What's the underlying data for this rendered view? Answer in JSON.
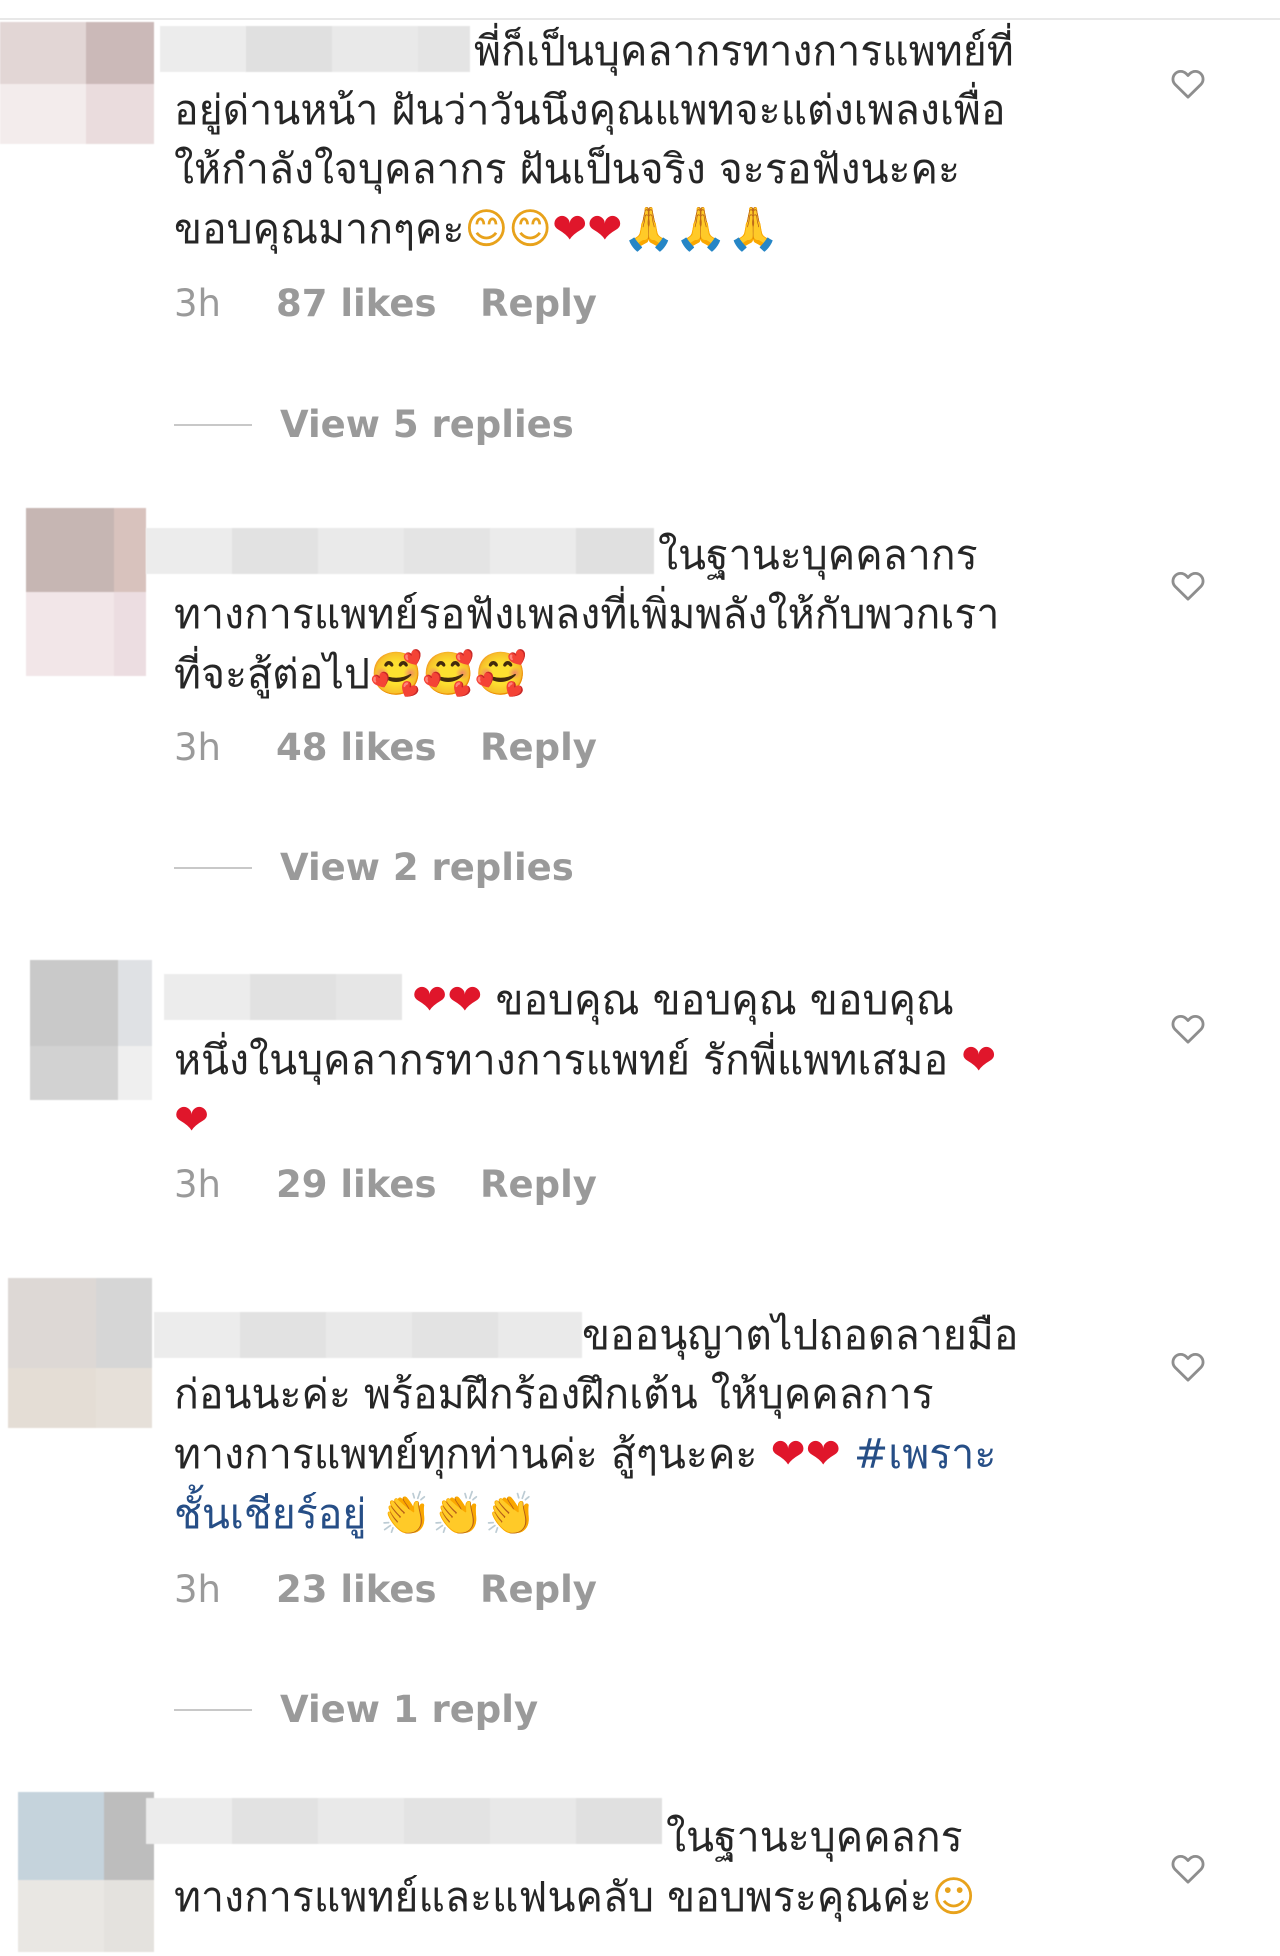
{
  "comments": [
    {
      "lead": "พี่ก็เป็นบุคลากรทางการแพทย์ที่",
      "lines": [
        "อยู่ด่านหน้า ฝันว่าวันนึงคุณแพทจะแต่งเพลงเพื่อ",
        "ให้กำลังใจบุคลากร ฝันเป็นจริง จะรอฟังนะคะ",
        "ขอบคุณมากๆคะ"
      ],
      "emoji": [
        "😊",
        "😊",
        "❤",
        "❤",
        "🙏",
        "🙏",
        "🙏"
      ],
      "time": "3h",
      "likes": "87 likes",
      "reply": "Reply",
      "view_replies": "View 5 replies"
    },
    {
      "lead": "ในฐานะบุคคลากร",
      "lines": [
        "ทางการแพทย์รอฟังเพลงที่เพิ่มพลังให้กับพวกเรา",
        "ที่จะสู้ต่อไป"
      ],
      "emoji": [
        "🥰",
        "🥰",
        "🥰"
      ],
      "time": "3h",
      "likes": "48 likes",
      "reply": "Reply",
      "view_replies": "View 2 replies"
    },
    {
      "lead": "ขอบคุณ ขอบคุณ ขอบคุณ",
      "lead_emoji": [
        "❤",
        "❤"
      ],
      "lines": [
        "หนึ่งในบุคลากรทางการแพทย์ รักพี่แพทเสมอ"
      ],
      "emoji": [
        "❤"
      ],
      "trailing_emoji": [
        "❤"
      ],
      "time": "3h",
      "likes": "29 likes",
      "reply": "Reply"
    },
    {
      "lead": "ขออนุญาตไปถอดลายมือ",
      "lines": [
        "ก่อนนะค่ะ พร้อมฝึกร้องฝึกเต้น ให้บุคคลการ",
        "ทางการแพทย์ทุกท่านค่ะ สู้ๆนะคะ"
      ],
      "emoji": [
        "❤",
        "❤"
      ],
      "hashtag_part1": "#เพราะ",
      "hashtag_part2": "ชั้นเชียร์อยู่",
      "trailing_emoji": [
        "👏",
        "👏",
        "👏"
      ],
      "time": "3h",
      "likes": "23 likes",
      "reply": "Reply",
      "view_replies": "View 1 reply"
    },
    {
      "lead": "ในฐานะบุคคลกร",
      "lines": [
        "ทางการแพทย์และแฟนคลับ ขอบพระคุณค่ะ"
      ],
      "emoji": [
        "☺"
      ]
    }
  ]
}
